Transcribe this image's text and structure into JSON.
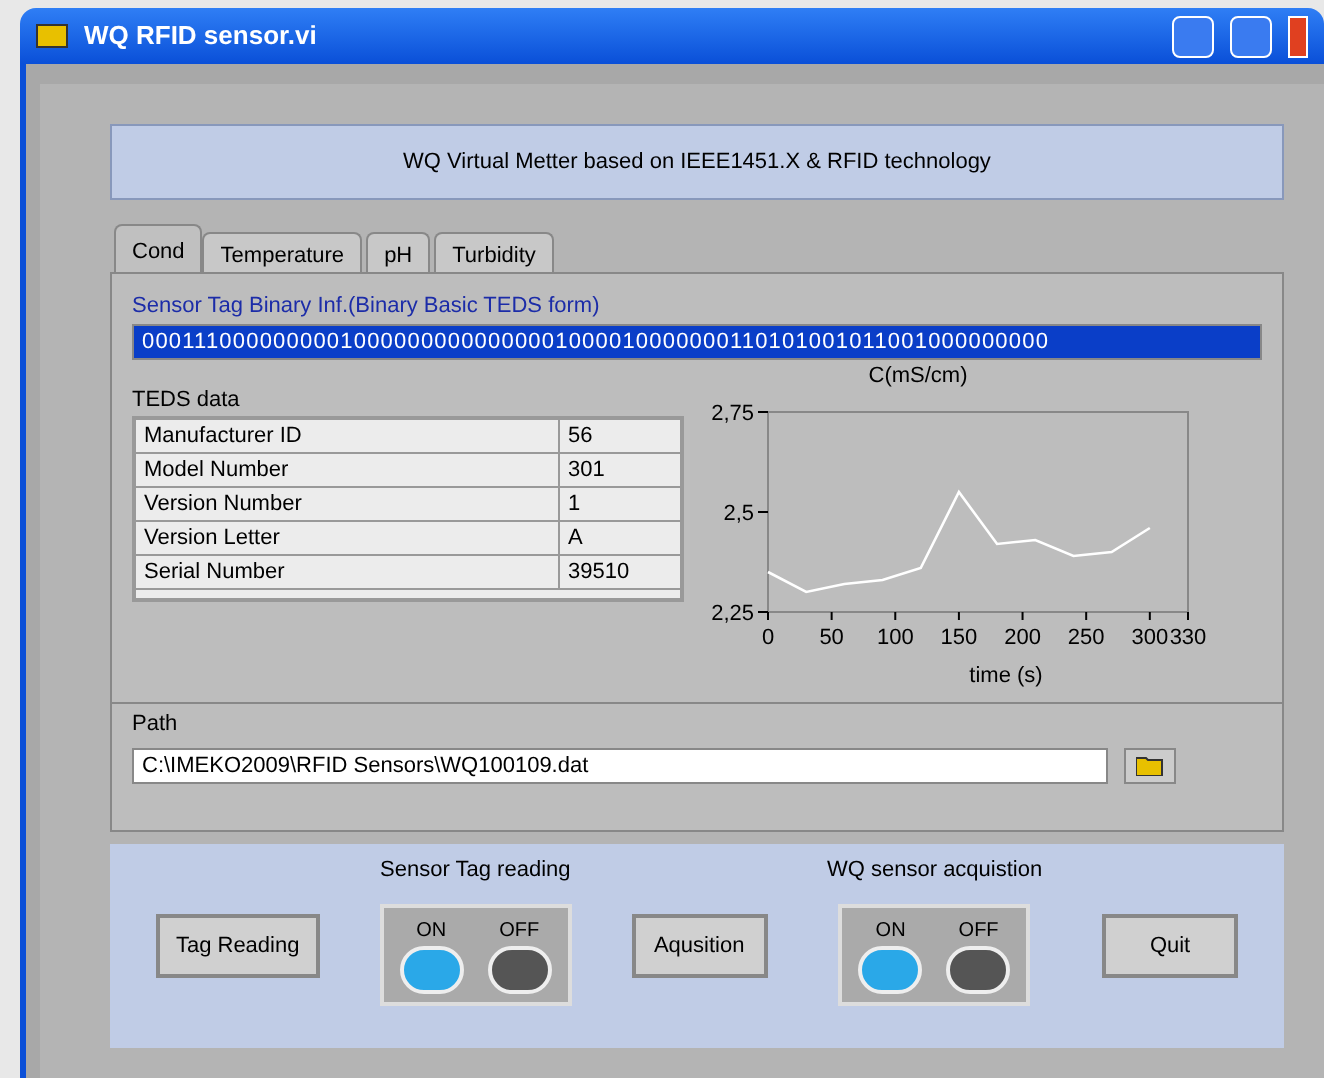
{
  "window": {
    "title": "WQ RFID sensor.vi"
  },
  "banner": "WQ Virtual Metter based on IEEE1451.X & RFID technology",
  "tabs": [
    {
      "label": "Cond",
      "selected": true
    },
    {
      "label": "Temperature",
      "selected": false
    },
    {
      "label": "pH",
      "selected": false
    },
    {
      "label": "Turbidity",
      "selected": false
    }
  ],
  "binary": {
    "label": "Sensor Tag Binary Inf.(Binary Basic TEDS form)",
    "value": "00011100000000010000000000000001000010000000110101001011001000000000"
  },
  "teds": {
    "label": "TEDS data",
    "rows": [
      {
        "name": "Manufacturer ID",
        "value": "56"
      },
      {
        "name": "Model Number",
        "value": "301"
      },
      {
        "name": "Version Number",
        "value": "1"
      },
      {
        "name": "Version Letter",
        "value": "A"
      },
      {
        "name": "Serial Number",
        "value": "39510"
      }
    ]
  },
  "chart": {
    "chart_data": {
      "type": "line",
      "ylabel": "C(mS/cm)",
      "xlabel": "time (s)",
      "x": [
        0,
        30,
        60,
        90,
        120,
        150,
        180,
        210,
        240,
        270,
        300
      ],
      "series": [
        {
          "color": "#ffffff",
          "values": [
            2.35,
            2.3,
            2.32,
            2.33,
            2.36,
            2.55,
            2.42,
            2.43,
            2.39,
            2.4,
            2.46
          ]
        }
      ],
      "xlim": [
        0,
        330
      ],
      "ylim": [
        2.25,
        2.75
      ],
      "xticks": [
        0,
        50,
        100,
        150,
        200,
        250,
        300,
        330
      ],
      "yticks": [
        {
          "value": 2.25,
          "label": "2,25"
        },
        {
          "value": 2.5,
          "label": "2,5"
        },
        {
          "value": 2.75,
          "label": "2,75"
        }
      ]
    }
  },
  "path": {
    "label": "Path",
    "value": "C:\\IMEKO2009\\RFID Sensors\\WQ100109.dat"
  },
  "controls": [
    {
      "kind": "button",
      "label": "Tag Reading"
    },
    {
      "kind": "switch",
      "title": "Sensor Tag reading",
      "on_label": "ON",
      "off_label": "OFF",
      "on": true
    },
    {
      "kind": "button",
      "label": "Aqusition"
    },
    {
      "kind": "switch",
      "title": "WQ sensor acquistion",
      "on_label": "ON",
      "off_label": "OFF",
      "on": true
    },
    {
      "kind": "button",
      "label": "Quit"
    }
  ]
}
